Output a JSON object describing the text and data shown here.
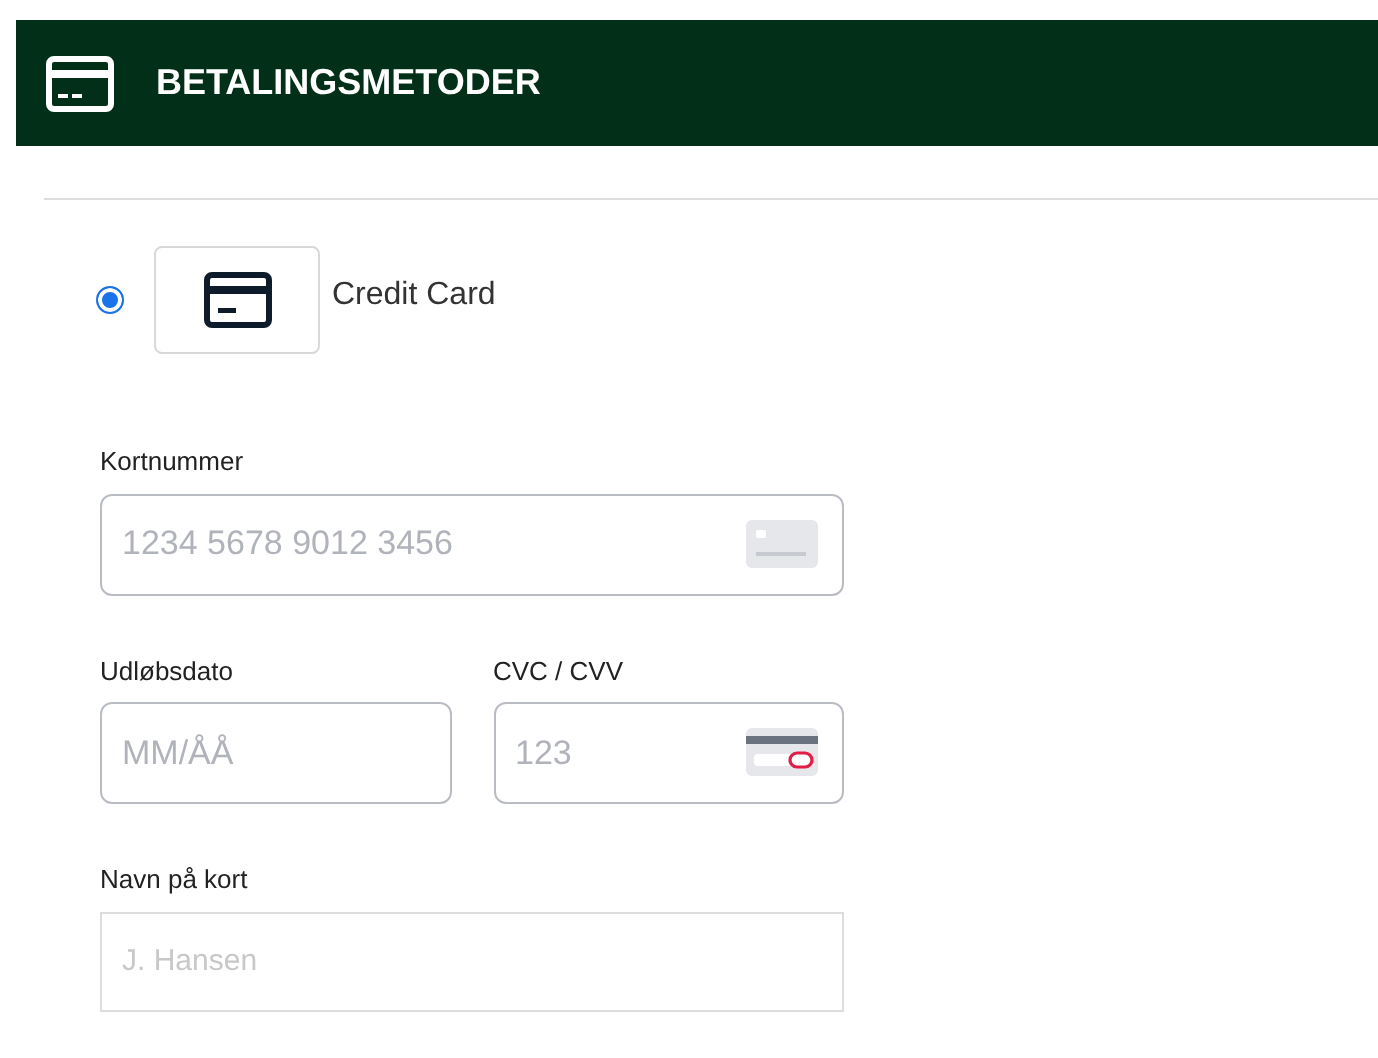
{
  "header": {
    "title": "BETALINGSMETODER"
  },
  "payment_options": [
    {
      "label": "Credit Card",
      "selected": true
    }
  ],
  "form_rows": [
    [
      {
        "kind": "card-number",
        "label": "Kortnummer",
        "placeholder": "1234 5678 9012 3456"
      }
    ],
    [
      {
        "kind": "expiry",
        "label": "Udløbsdato",
        "placeholder": "MM/ÅÅ"
      },
      {
        "kind": "cvc",
        "label": "CVC / CVV",
        "placeholder": "123"
      }
    ],
    [
      {
        "kind": "plain",
        "label": "Navn på kort",
        "placeholder": "J. Hansen"
      }
    ]
  ]
}
